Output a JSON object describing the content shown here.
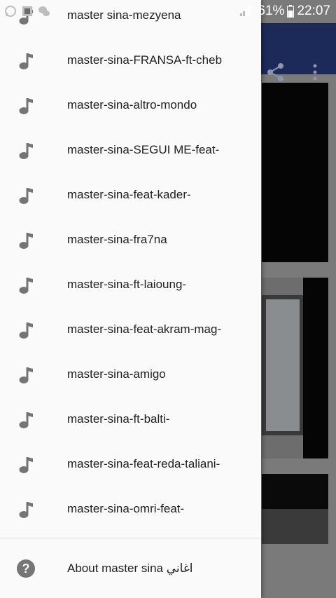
{
  "status_bar": {
    "battery": "61%",
    "time": "22:07",
    "left_icons": [
      "whatsapp-icon",
      "gallery-icon",
      "wechat-icon"
    ]
  },
  "app_bar": {
    "share_icon": "share-icon",
    "more_icon": "more-vert-icon",
    "color": "#1c2a5a"
  },
  "drawer": {
    "items": [
      {
        "label": "master sina-mezyena"
      },
      {
        "label": "master-sina-FRANSA-ft-cheb"
      },
      {
        "label": "master-sina-altro-mondo"
      },
      {
        "label": "master-sina-SEGUI ME-feat-"
      },
      {
        "label": "master-sina-feat-kader-"
      },
      {
        "label": "master-sina-fra7na"
      },
      {
        "label": "master-sina-ft-laioung-"
      },
      {
        "label": "master-sina-feat-akram-mag-"
      },
      {
        "label": "master-sina-amigo"
      },
      {
        "label": "master-sina-ft-balti-"
      },
      {
        "label": "master-sina-feat-reda-taliani-"
      },
      {
        "label": "master-sina-omri-feat-"
      }
    ],
    "about_label": "About master sina اغاني",
    "item_icon": "music-note-icon",
    "about_icon": "help-icon"
  }
}
